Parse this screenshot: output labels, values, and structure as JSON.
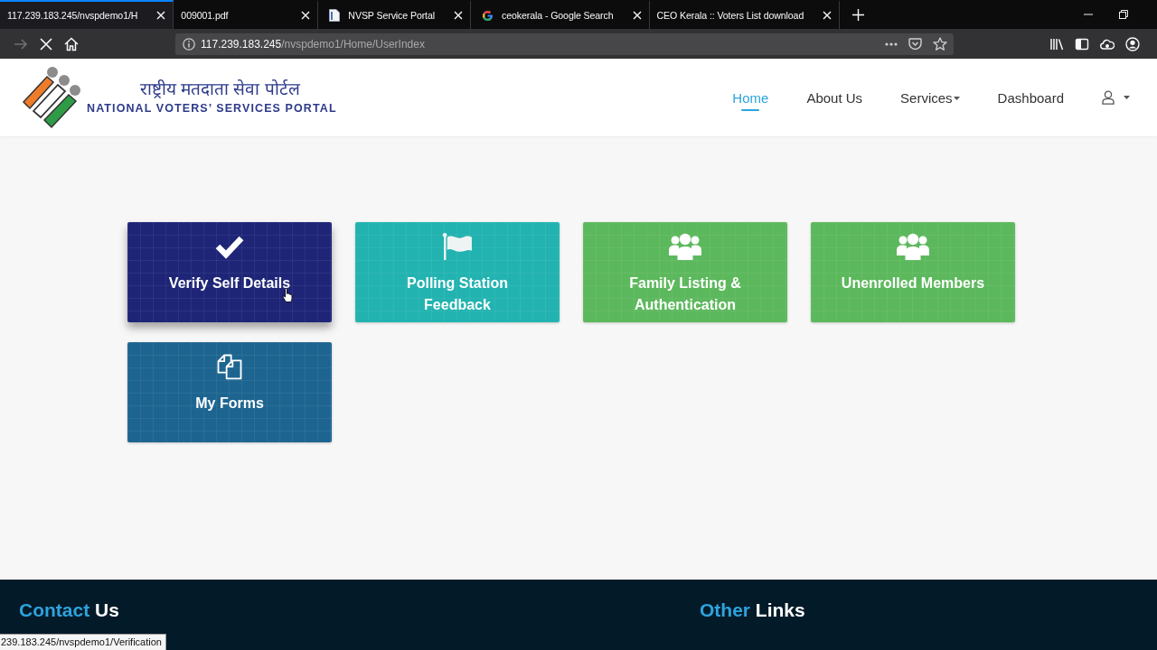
{
  "browser": {
    "tabs": [
      {
        "title": "117.239.183.245/nvspdemo1/H",
        "kind": "plain",
        "selected": true
      },
      {
        "title": "009001.pdf",
        "kind": "plain",
        "selected": false
      },
      {
        "title": "NVSP Service Portal",
        "kind": "document",
        "selected": false
      },
      {
        "title": "ceokerala - Google Search",
        "kind": "search",
        "selected": false
      },
      {
        "title": "CEO Kerala :: Voters List download",
        "kind": "plain",
        "selected": false
      }
    ],
    "loading": true,
    "address": {
      "host": "117.239.183.245",
      "path": "/nvspdemo1/Home/UserIndex"
    }
  },
  "header": {
    "logo": {
      "hindi": "राष्ट्रीय मतदाता सेवा पोर्टल",
      "english": "NATIONAL VOTERS’ SERVICES PORTAL"
    },
    "nav": [
      {
        "label": "Home",
        "selected": true,
        "dropdown": false
      },
      {
        "label": "About Us",
        "selected": false,
        "dropdown": false
      },
      {
        "label": "Services",
        "selected": false,
        "dropdown": true
      },
      {
        "label": "Dashboard",
        "selected": false,
        "dropdown": false
      }
    ]
  },
  "tiles": [
    {
      "label": "Verify Self Details",
      "kind": "check",
      "color": "#1e2577",
      "hovered": true
    },
    {
      "label": "Polling Station Feedback",
      "kind": "flag",
      "color": "#22b3b0",
      "hovered": false
    },
    {
      "label": "Family Listing & Authentication",
      "kind": "group",
      "color": "#5cb85c",
      "hovered": false
    },
    {
      "label": "Unenrolled Members",
      "kind": "group",
      "color": "#5cb85c",
      "hovered": false
    },
    {
      "label": "My Forms",
      "kind": "files",
      "color": "#1d6590",
      "hovered": false
    }
  ],
  "footer": {
    "columns": [
      {
        "accent": "Contact",
        "rest": "Us"
      },
      {
        "accent": "Other",
        "rest": "Links"
      }
    ]
  },
  "status_bar": {
    "url": "239.183.245/nvspdemo1/Verification"
  }
}
